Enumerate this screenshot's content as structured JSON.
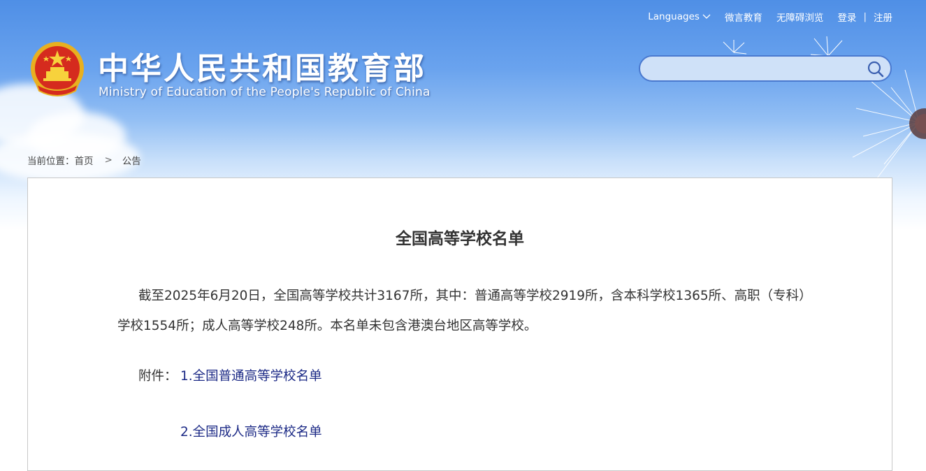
{
  "header": {
    "site_title": "中华人民共和国教育部",
    "site_subtitle": "Ministry of Education of the People's Republic of China",
    "emblem_icon": "national-emblem-icon"
  },
  "top_nav": {
    "languages": "Languages",
    "weiyan": "微言教育",
    "accessibility": "无障碍浏览",
    "login": "登录",
    "separator": "|",
    "register": "注册"
  },
  "search": {
    "placeholder": "",
    "value": "",
    "icon": "search-icon"
  },
  "breadcrumb": {
    "prefix": "当前位置：",
    "home": "首页",
    "arrow": ">",
    "current": "公告"
  },
  "article": {
    "title": "全国高等学校名单",
    "paragraph": "截至2025年6月20日，全国高等学校共计3167所，其中：普通高等学校2919所，含本科学校1365所、高职（专科）学校1554所；成人高等学校248所。本名单未包含港澳台地区高等学校。",
    "attachment_label": "附件：",
    "attachments": [
      {
        "label": "1.全国普通高等学校名单"
      },
      {
        "label": "2.全国成人高等学校名单"
      }
    ]
  },
  "colors": {
    "header_blue": "#4f8fe6",
    "search_border": "#4a79cf",
    "link": "#1c2a86",
    "text": "#333333"
  }
}
